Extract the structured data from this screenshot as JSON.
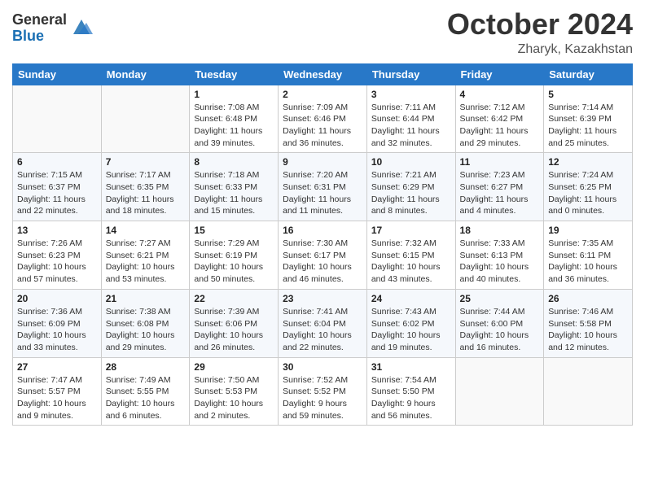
{
  "header": {
    "logo_general": "General",
    "logo_blue": "Blue",
    "month": "October 2024",
    "location": "Zharyk, Kazakhstan"
  },
  "days_of_week": [
    "Sunday",
    "Monday",
    "Tuesday",
    "Wednesday",
    "Thursday",
    "Friday",
    "Saturday"
  ],
  "weeks": [
    [
      {
        "day": "",
        "sunrise": "",
        "sunset": "",
        "daylight": ""
      },
      {
        "day": "",
        "sunrise": "",
        "sunset": "",
        "daylight": ""
      },
      {
        "day": "1",
        "sunrise": "Sunrise: 7:08 AM",
        "sunset": "Sunset: 6:48 PM",
        "daylight": "Daylight: 11 hours and 39 minutes."
      },
      {
        "day": "2",
        "sunrise": "Sunrise: 7:09 AM",
        "sunset": "Sunset: 6:46 PM",
        "daylight": "Daylight: 11 hours and 36 minutes."
      },
      {
        "day": "3",
        "sunrise": "Sunrise: 7:11 AM",
        "sunset": "Sunset: 6:44 PM",
        "daylight": "Daylight: 11 hours and 32 minutes."
      },
      {
        "day": "4",
        "sunrise": "Sunrise: 7:12 AM",
        "sunset": "Sunset: 6:42 PM",
        "daylight": "Daylight: 11 hours and 29 minutes."
      },
      {
        "day": "5",
        "sunrise": "Sunrise: 7:14 AM",
        "sunset": "Sunset: 6:39 PM",
        "daylight": "Daylight: 11 hours and 25 minutes."
      }
    ],
    [
      {
        "day": "6",
        "sunrise": "Sunrise: 7:15 AM",
        "sunset": "Sunset: 6:37 PM",
        "daylight": "Daylight: 11 hours and 22 minutes."
      },
      {
        "day": "7",
        "sunrise": "Sunrise: 7:17 AM",
        "sunset": "Sunset: 6:35 PM",
        "daylight": "Daylight: 11 hours and 18 minutes."
      },
      {
        "day": "8",
        "sunrise": "Sunrise: 7:18 AM",
        "sunset": "Sunset: 6:33 PM",
        "daylight": "Daylight: 11 hours and 15 minutes."
      },
      {
        "day": "9",
        "sunrise": "Sunrise: 7:20 AM",
        "sunset": "Sunset: 6:31 PM",
        "daylight": "Daylight: 11 hours and 11 minutes."
      },
      {
        "day": "10",
        "sunrise": "Sunrise: 7:21 AM",
        "sunset": "Sunset: 6:29 PM",
        "daylight": "Daylight: 11 hours and 8 minutes."
      },
      {
        "day": "11",
        "sunrise": "Sunrise: 7:23 AM",
        "sunset": "Sunset: 6:27 PM",
        "daylight": "Daylight: 11 hours and 4 minutes."
      },
      {
        "day": "12",
        "sunrise": "Sunrise: 7:24 AM",
        "sunset": "Sunset: 6:25 PM",
        "daylight": "Daylight: 11 hours and 0 minutes."
      }
    ],
    [
      {
        "day": "13",
        "sunrise": "Sunrise: 7:26 AM",
        "sunset": "Sunset: 6:23 PM",
        "daylight": "Daylight: 10 hours and 57 minutes."
      },
      {
        "day": "14",
        "sunrise": "Sunrise: 7:27 AM",
        "sunset": "Sunset: 6:21 PM",
        "daylight": "Daylight: 10 hours and 53 minutes."
      },
      {
        "day": "15",
        "sunrise": "Sunrise: 7:29 AM",
        "sunset": "Sunset: 6:19 PM",
        "daylight": "Daylight: 10 hours and 50 minutes."
      },
      {
        "day": "16",
        "sunrise": "Sunrise: 7:30 AM",
        "sunset": "Sunset: 6:17 PM",
        "daylight": "Daylight: 10 hours and 46 minutes."
      },
      {
        "day": "17",
        "sunrise": "Sunrise: 7:32 AM",
        "sunset": "Sunset: 6:15 PM",
        "daylight": "Daylight: 10 hours and 43 minutes."
      },
      {
        "day": "18",
        "sunrise": "Sunrise: 7:33 AM",
        "sunset": "Sunset: 6:13 PM",
        "daylight": "Daylight: 10 hours and 40 minutes."
      },
      {
        "day": "19",
        "sunrise": "Sunrise: 7:35 AM",
        "sunset": "Sunset: 6:11 PM",
        "daylight": "Daylight: 10 hours and 36 minutes."
      }
    ],
    [
      {
        "day": "20",
        "sunrise": "Sunrise: 7:36 AM",
        "sunset": "Sunset: 6:09 PM",
        "daylight": "Daylight: 10 hours and 33 minutes."
      },
      {
        "day": "21",
        "sunrise": "Sunrise: 7:38 AM",
        "sunset": "Sunset: 6:08 PM",
        "daylight": "Daylight: 10 hours and 29 minutes."
      },
      {
        "day": "22",
        "sunrise": "Sunrise: 7:39 AM",
        "sunset": "Sunset: 6:06 PM",
        "daylight": "Daylight: 10 hours and 26 minutes."
      },
      {
        "day": "23",
        "sunrise": "Sunrise: 7:41 AM",
        "sunset": "Sunset: 6:04 PM",
        "daylight": "Daylight: 10 hours and 22 minutes."
      },
      {
        "day": "24",
        "sunrise": "Sunrise: 7:43 AM",
        "sunset": "Sunset: 6:02 PM",
        "daylight": "Daylight: 10 hours and 19 minutes."
      },
      {
        "day": "25",
        "sunrise": "Sunrise: 7:44 AM",
        "sunset": "Sunset: 6:00 PM",
        "daylight": "Daylight: 10 hours and 16 minutes."
      },
      {
        "day": "26",
        "sunrise": "Sunrise: 7:46 AM",
        "sunset": "Sunset: 5:58 PM",
        "daylight": "Daylight: 10 hours and 12 minutes."
      }
    ],
    [
      {
        "day": "27",
        "sunrise": "Sunrise: 7:47 AM",
        "sunset": "Sunset: 5:57 PM",
        "daylight": "Daylight: 10 hours and 9 minutes."
      },
      {
        "day": "28",
        "sunrise": "Sunrise: 7:49 AM",
        "sunset": "Sunset: 5:55 PM",
        "daylight": "Daylight: 10 hours and 6 minutes."
      },
      {
        "day": "29",
        "sunrise": "Sunrise: 7:50 AM",
        "sunset": "Sunset: 5:53 PM",
        "daylight": "Daylight: 10 hours and 2 minutes."
      },
      {
        "day": "30",
        "sunrise": "Sunrise: 7:52 AM",
        "sunset": "Sunset: 5:52 PM",
        "daylight": "Daylight: 9 hours and 59 minutes."
      },
      {
        "day": "31",
        "sunrise": "Sunrise: 7:54 AM",
        "sunset": "Sunset: 5:50 PM",
        "daylight": "Daylight: 9 hours and 56 minutes."
      },
      {
        "day": "",
        "sunrise": "",
        "sunset": "",
        "daylight": ""
      },
      {
        "day": "",
        "sunrise": "",
        "sunset": "",
        "daylight": ""
      }
    ]
  ]
}
